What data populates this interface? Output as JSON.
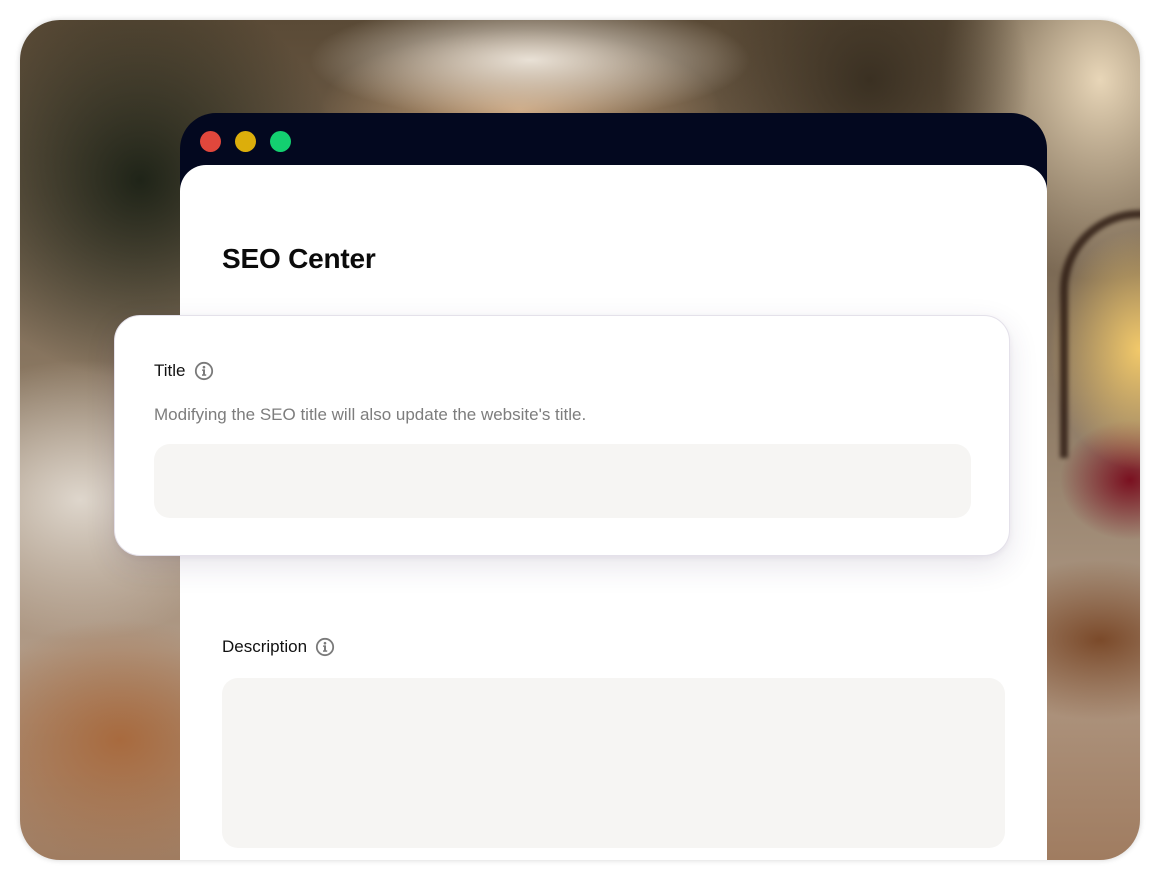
{
  "window": {
    "controls": [
      "close",
      "minimize",
      "maximize"
    ]
  },
  "page": {
    "title": "SEO Center"
  },
  "title_field": {
    "label": "Title",
    "help_text": "Modifying the SEO title will also update the website's title.",
    "value": "",
    "icon": "info-icon"
  },
  "description_field": {
    "label": "Description",
    "value": "",
    "icon": "info-icon"
  },
  "colors": {
    "window_chrome": "#03081f",
    "close_dot": "#e0473c",
    "minimize_dot": "#dcae0b",
    "maximize_dot": "#13d070",
    "input_background": "#f6f5f3",
    "help_text": "#7d7d7d"
  }
}
